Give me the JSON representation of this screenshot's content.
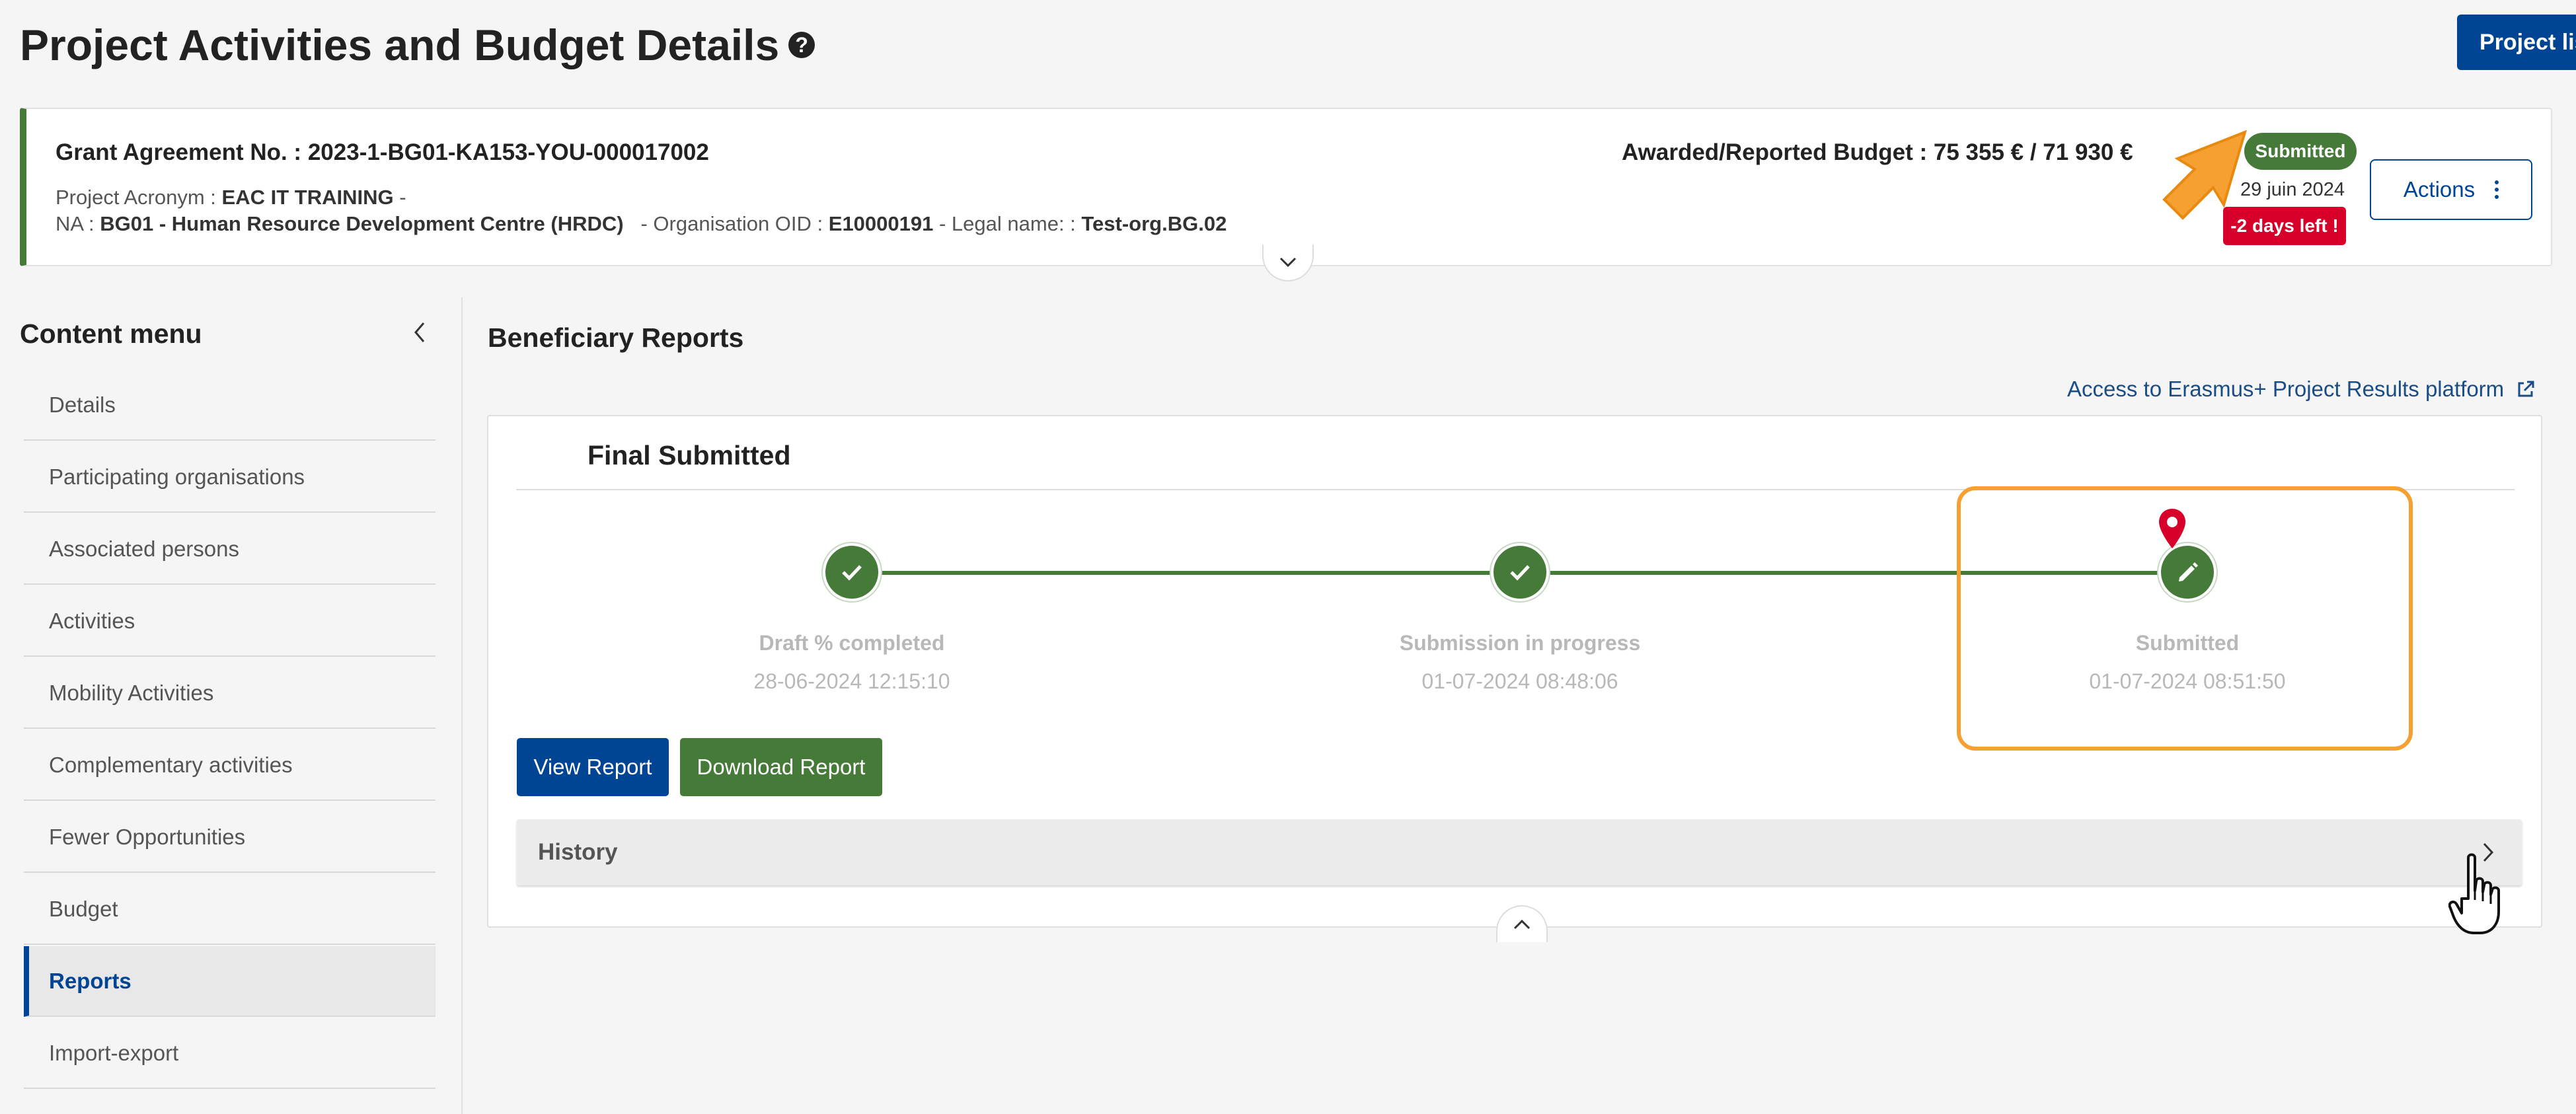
{
  "header": {
    "title": "Project Activities and Budget Details",
    "help_icon": "question-circle-icon",
    "project_list_label": "Project list"
  },
  "grant": {
    "agreement_label": "Grant Agreement No. :",
    "agreement_no": "2023-1-BG01-KA153-YOU-000017002",
    "acronym_label": "Project Acronym :",
    "acronym": "EAC IT TRAINING",
    "acronym_suffix": "-",
    "na_label": "NA :",
    "na_value": "BG01 - Human Resource Development Centre (HRDC)",
    "oid_label": "- Organisation OID :",
    "oid_value": "E10000191",
    "legal_label": "- Legal name: :",
    "legal_value": "Test-org.BG.02",
    "budget_text": "Awarded/Reported Budget : 75 355 € / 71 930 €",
    "status": "Submitted",
    "date_partial": "29 juin 2024",
    "days_left": "-2 days left !",
    "actions_label": "Actions",
    "status_color": "#467a39",
    "alert_color": "#d6002a"
  },
  "sidebar": {
    "title": "Content menu",
    "items": [
      {
        "label": "Details"
      },
      {
        "label": "Participating organisations"
      },
      {
        "label": "Associated persons"
      },
      {
        "label": "Activities"
      },
      {
        "label": "Mobility Activities"
      },
      {
        "label": "Complementary activities"
      },
      {
        "label": "Fewer Opportunities"
      },
      {
        "label": "Budget"
      },
      {
        "label": "Reports",
        "active": true
      },
      {
        "label": "Import-export"
      }
    ]
  },
  "main": {
    "section_title": "Beneficiary Reports",
    "external_link": "Access to Erasmus+ Project Results platform",
    "card_title": "Final Submitted",
    "steps": [
      {
        "label": "Draft % completed",
        "date": "28-06-2024 12:15:10",
        "icon": "check-icon"
      },
      {
        "label": "Submission in progress",
        "date": "01-07-2024 08:48:06",
        "icon": "check-icon"
      },
      {
        "label": "Submitted",
        "date": "01-07-2024 08:51:50",
        "icon": "pencil-icon"
      }
    ],
    "view_report": "View Report",
    "download_report": "Download Report",
    "history": "History"
  },
  "colors": {
    "primary_blue": "#004494",
    "success_green": "#467a39",
    "highlight_orange": "#f7a032",
    "pin_red": "#d6002a"
  }
}
